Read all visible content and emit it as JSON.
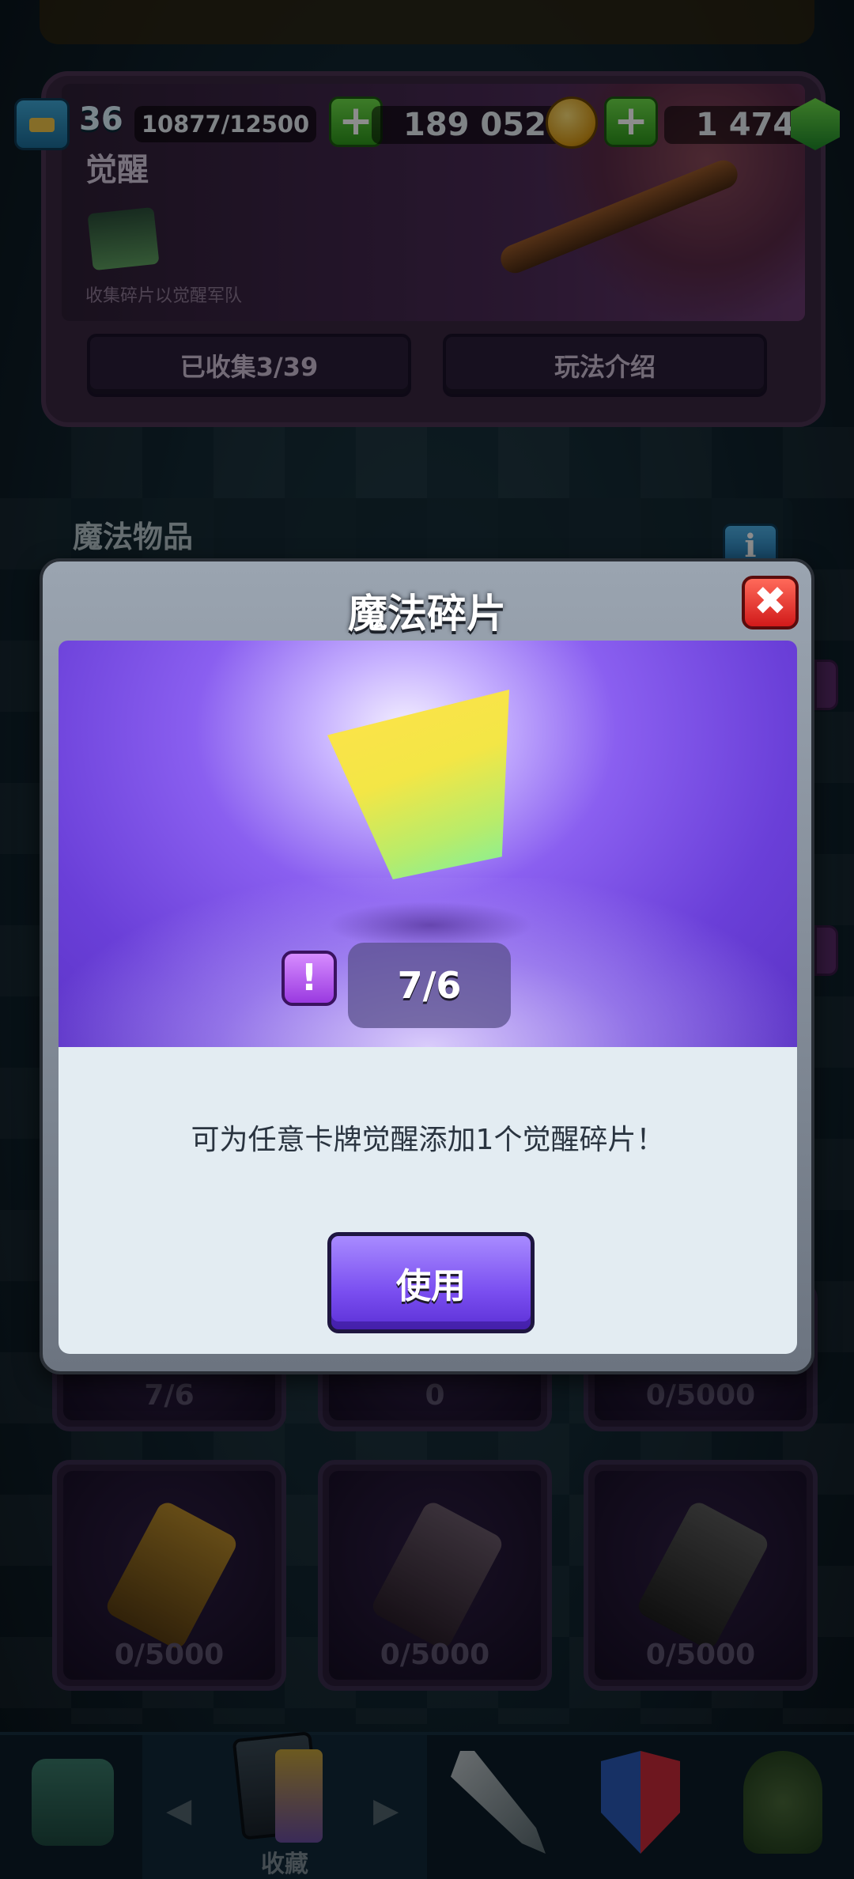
{
  "resources": {
    "level": "36",
    "xp": "10877/12500",
    "gold": "189 052",
    "gems": "1 474",
    "plus_symbol": "+"
  },
  "awakening": {
    "title": "觉醒",
    "subtitle": "收集碎片以觉醒军队",
    "collected_button": "已收集3/39",
    "howto_button": "玩法介绍"
  },
  "magic_items": {
    "header": "魔法物品",
    "info_symbol": "i"
  },
  "item_grid": {
    "row1_counts": [
      "7/6",
      "0",
      "0/5000"
    ],
    "row2_counts": [
      "0/5000",
      "0/5000",
      "0/5000"
    ]
  },
  "bottom_nav": {
    "collection_label": "收藏",
    "prev_arrow": "◀",
    "next_arrow": "▶"
  },
  "modal": {
    "title": "魔法碎片",
    "close_symbol": "✖",
    "alert_symbol": "!",
    "progress": "7/6",
    "description": "可为任意卡牌觉醒添加1个觉醒碎片！",
    "use_button": "使用"
  },
  "colors": {
    "modal_accent": "#7a4ef0",
    "close_red": "#d11a1a",
    "gold": "#d99a16",
    "gem_green": "#2f9a1c"
  }
}
